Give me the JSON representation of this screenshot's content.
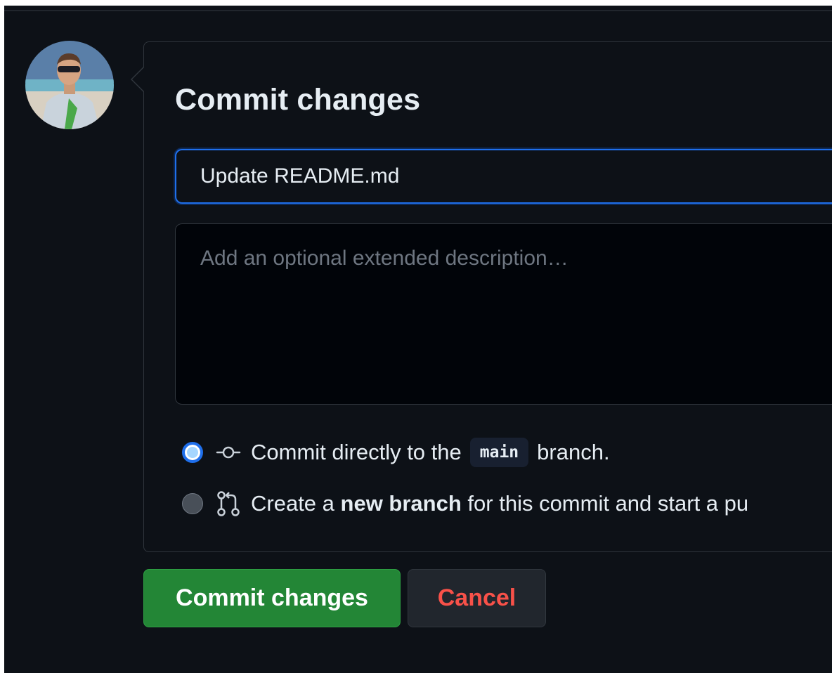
{
  "dialog": {
    "title": "Commit changes",
    "summary_value": "Update README.md",
    "description_placeholder": "Add an optional extended description…"
  },
  "options": {
    "direct": {
      "prefix": "Commit directly to the",
      "branch": "main",
      "suffix": "branch.",
      "selected": true,
      "icon": "git-commit-icon"
    },
    "new_branch": {
      "prefix": "Create a",
      "bold": "new branch",
      "suffix": "for this commit and start a pu",
      "selected": false,
      "icon": "git-pull-request-icon"
    }
  },
  "buttons": {
    "commit": "Commit changes",
    "cancel": "Cancel"
  },
  "colors": {
    "background": "#0d1117",
    "accent_blue": "#1f6feb",
    "primary_green": "#238636",
    "danger_red": "#f85149"
  }
}
